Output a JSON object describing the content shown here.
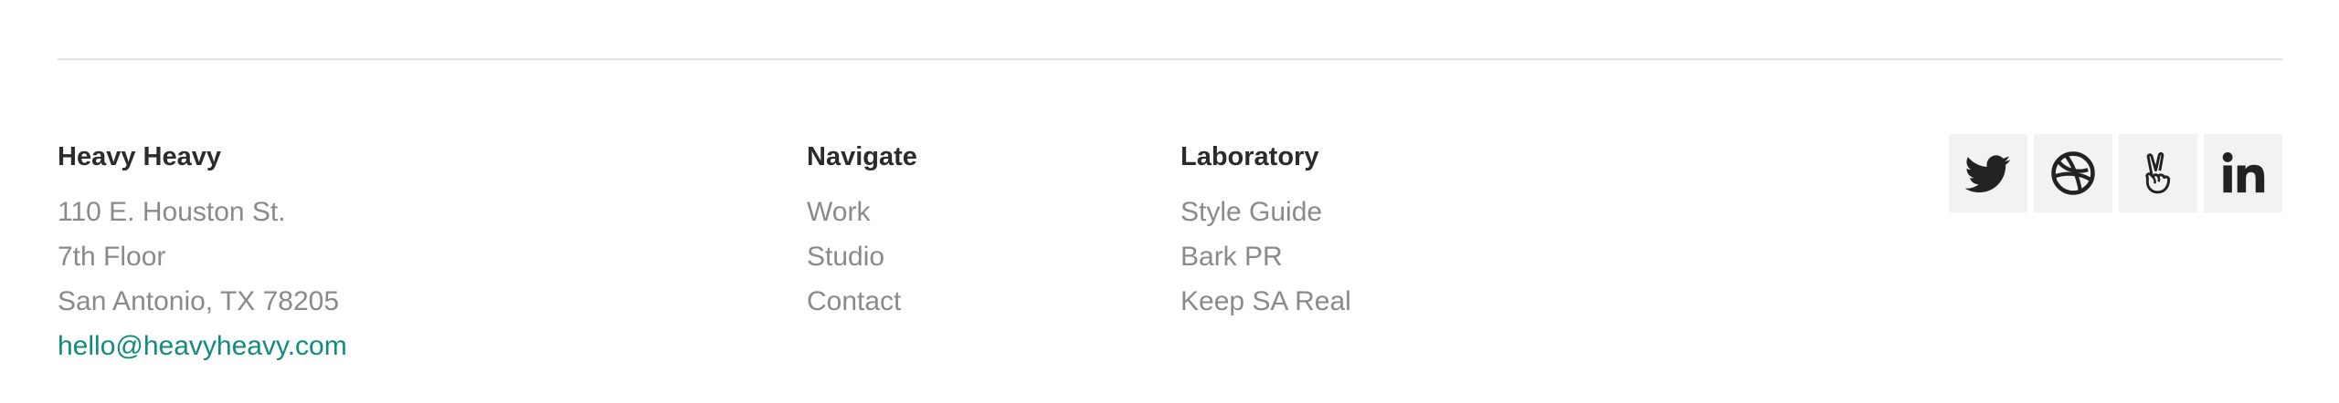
{
  "company": {
    "name": "Heavy Heavy",
    "address_line1": "110 E. Houston St.",
    "address_line2": "7th Floor",
    "address_line3": "San Antonio, TX 78205",
    "email": "hello@heavyheavy.com"
  },
  "navigate": {
    "heading": "Navigate",
    "links": [
      "Work",
      "Studio",
      "Contact"
    ]
  },
  "laboratory": {
    "heading": "Laboratory",
    "links": [
      "Style Guide",
      "Bark PR",
      "Keep SA Real"
    ]
  },
  "social": {
    "icons": [
      "twitter-icon",
      "dribbble-icon",
      "angellist-icon",
      "linkedin-icon"
    ]
  },
  "colors": {
    "heading": "#2b2b2b",
    "body_text": "#8a8a8a",
    "email_link": "#138a7e",
    "icon_bg": "#f2f2f2",
    "icon_fg": "#222222",
    "divider": "#e3e3e3"
  }
}
